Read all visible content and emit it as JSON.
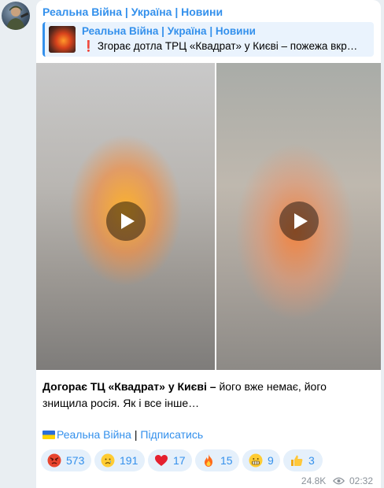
{
  "channel": {
    "name": "Реальна Війна | Україна | Новини"
  },
  "reply": {
    "title": "Реальна Війна | Україна | Новини",
    "text": "Згорає дотла ТРЦ «Квадрат» у Києві – пожежа вкр…"
  },
  "caption": {
    "bold": "Догорає ТЦ «Квадрат» у Києві –",
    "rest": " його вже немає, його знищила росія. Як і все інше…"
  },
  "signature": {
    "link": "Реальна Війна",
    "separator": " | ",
    "subscribe": "Підписатись"
  },
  "reactions": [
    {
      "icon": "angry-face-icon",
      "count": "573"
    },
    {
      "icon": "crying-face-icon",
      "count": "191"
    },
    {
      "icon": "red-heart-icon",
      "count": "17"
    },
    {
      "icon": "fire-icon",
      "count": "15"
    },
    {
      "icon": "grimacing-face-icon",
      "count": "9"
    },
    {
      "icon": "thumbs-up-icon",
      "count": "3"
    }
  ],
  "meta": {
    "views": "24.8K",
    "time": "02:32"
  },
  "colors": {
    "accent": "#3390ec",
    "reaction_bg": "#e5f0fb",
    "page_bg": "#e9eef2",
    "alert": "#e53935"
  }
}
